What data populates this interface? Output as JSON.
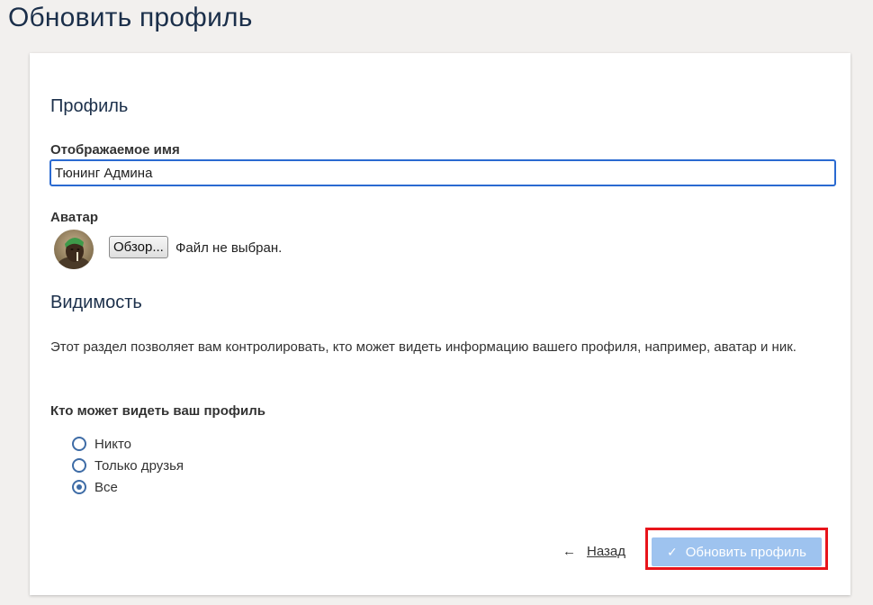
{
  "page": {
    "title": "Обновить профиль"
  },
  "profile": {
    "heading": "Профиль",
    "display_name_label": "Отображаемое имя",
    "display_name_value": "Тюнинг Админа",
    "avatar_label": "Аватар",
    "browse_label": "Обзор...",
    "file_status": "Файл не выбран."
  },
  "visibility": {
    "heading": "Видимость",
    "description": "Этот раздел позволяет вам контролировать, кто может видеть информацию вашего профиля, например, аватар и ник.",
    "question": "Кто может видеть ваш профиль",
    "options": [
      {
        "label": "Никто",
        "checked": false
      },
      {
        "label": "Только друзья",
        "checked": false
      },
      {
        "label": "Все",
        "checked": true
      }
    ]
  },
  "actions": {
    "back_label": "Назад",
    "submit_label": "Обновить профиль"
  },
  "colors": {
    "accent": "#2a6ad1",
    "radio": "#3e6ca6",
    "submit_bg": "#9ec3ef",
    "highlight": "#e8141b"
  },
  "icons": {
    "back": "arrow-left-icon",
    "submit": "check-icon"
  }
}
